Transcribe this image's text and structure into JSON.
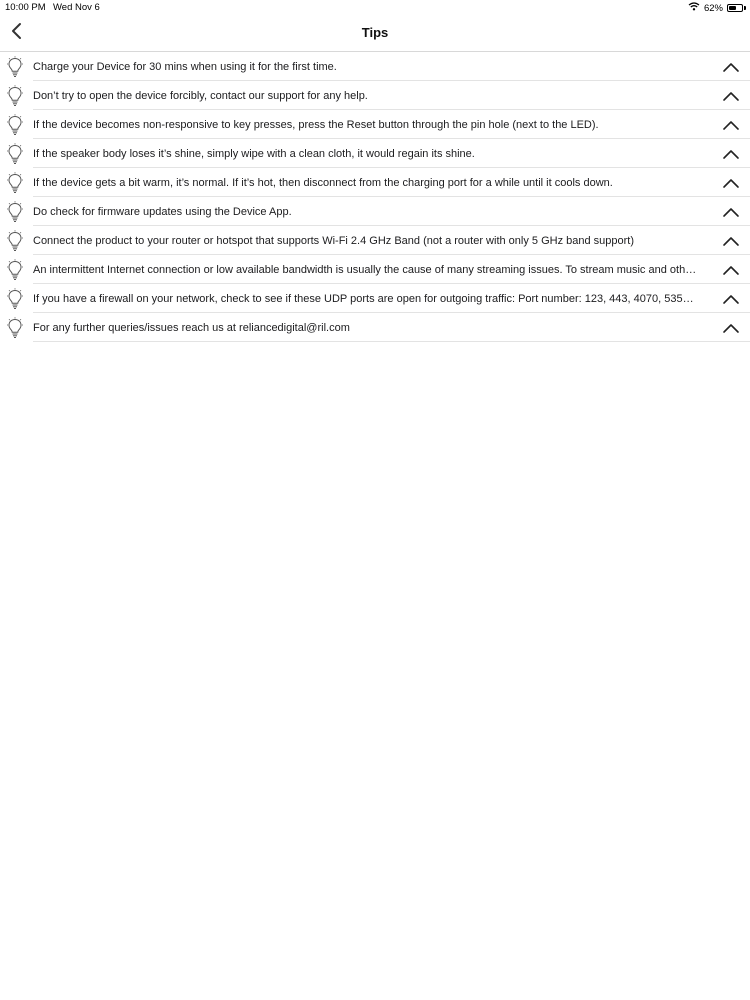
{
  "status_bar": {
    "time": "10:00 PM",
    "date": "Wed Nov 6",
    "battery_percent_label": "62%",
    "battery_level": 0.62,
    "wifi_icon": "wifi-icon",
    "battery_icon": "battery-icon"
  },
  "nav": {
    "title": "Tips",
    "back_icon": "chevron-left-icon"
  },
  "tips": [
    {
      "text": "Charge your Device for 30 mins when using it for the first time.",
      "icon": "lightbulb-icon",
      "toggle_icon": "chevron-up-icon"
    },
    {
      "text": "Don’t try to open the device forcibly, contact our support for any help.",
      "icon": "lightbulb-icon",
      "toggle_icon": "chevron-up-icon"
    },
    {
      "text": "If the device becomes non-responsive to key presses, press the Reset button through the pin hole (next to the LED).",
      "icon": "lightbulb-icon",
      "toggle_icon": "chevron-up-icon"
    },
    {
      "text": "If the speaker body loses it’s shine, simply wipe with a clean cloth, it would regain its shine.",
      "icon": "lightbulb-icon",
      "toggle_icon": "chevron-up-icon"
    },
    {
      "text": "If the device gets a bit warm, it’s normal. If it’s hot, then disconnect from the charging port for a while until it cools down.",
      "icon": "lightbulb-icon",
      "toggle_icon": "chevron-up-icon"
    },
    {
      "text": "Do check for firmware updates using the Device App.",
      "icon": "lightbulb-icon",
      "toggle_icon": "chevron-up-icon"
    },
    {
      "text": "Connect the product to your router or hotspot that supports Wi-Fi 2.4 GHz Band (not a router with only 5 GHz band support)",
      "icon": "lightbulb-icon",
      "toggle_icon": "chevron-up-icon"
    },
    {
      "text": "An intermittent Internet connection or low available bandwidth is usually the cause of many streaming issues. To stream music and oth…",
      "icon": "lightbulb-icon",
      "toggle_icon": "chevron-up-icon"
    },
    {
      "text": "If you have a firewall on your network, check to see if these UDP ports are open for outgoing traffic: Port number:  123, 443, 4070, 535…",
      "icon": "lightbulb-icon",
      "toggle_icon": "chevron-up-icon"
    },
    {
      "text": "For any further queries/issues reach us at reliancedigital@ril.com",
      "icon": "lightbulb-icon",
      "toggle_icon": "chevron-up-icon"
    }
  ],
  "colors": {
    "text": "#1c1c1e",
    "icon": "#555555",
    "separator": "#e3e3e3"
  }
}
